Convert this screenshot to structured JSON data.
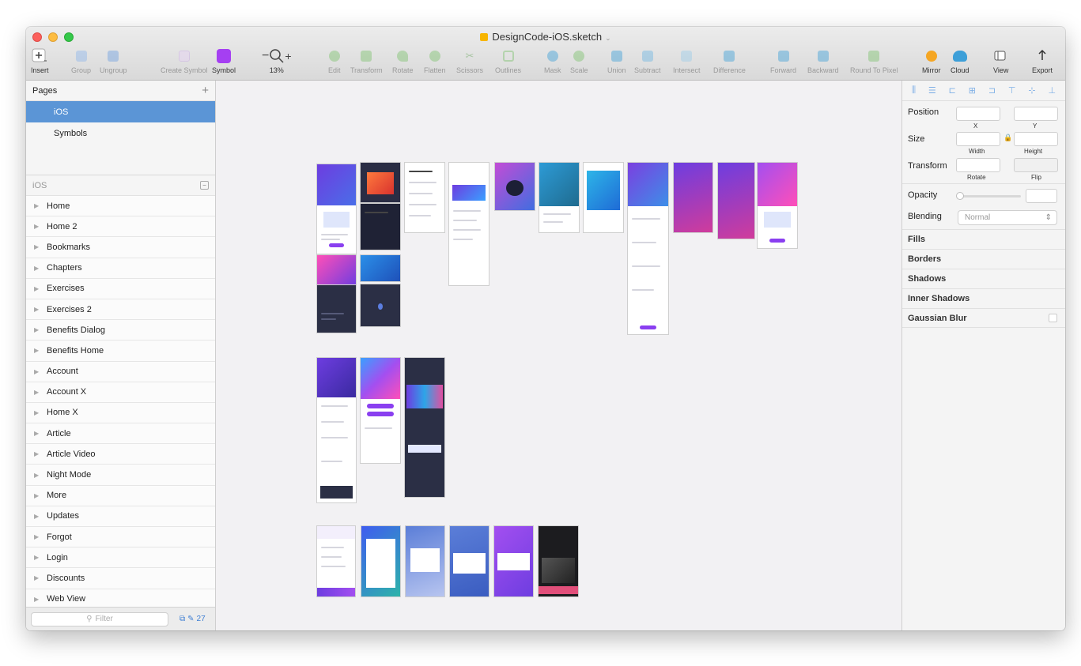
{
  "window": {
    "title": "DesignCode-iOS.sketch"
  },
  "toolbar": {
    "insert": "Insert",
    "group": "Group",
    "ungroup": "Ungroup",
    "create_symbol": "Create Symbol",
    "symbol": "Symbol",
    "zoom_minus": "−",
    "zoom_plus": "+",
    "zoom": "13%",
    "edit": "Edit",
    "transform": "Transform",
    "rotate": "Rotate",
    "flatten": "Flatten",
    "scissors": "Scissors",
    "outlines": "Outlines",
    "mask": "Mask",
    "scale": "Scale",
    "union": "Union",
    "subtract": "Subtract",
    "intersect": "Intersect",
    "difference": "Difference",
    "forward": "Forward",
    "backward": "Backward",
    "round_to_pixel": "Round To Pixel",
    "mirror": "Mirror",
    "cloud": "Cloud",
    "view": "View",
    "export": "Export"
  },
  "sidebar": {
    "pages_title": "Pages",
    "add": "+",
    "pages": [
      {
        "label": "iOS",
        "selected": true
      },
      {
        "label": "Symbols",
        "selected": false
      }
    ],
    "layers_title": "iOS",
    "layers": [
      "Home",
      "Home 2",
      "Bookmarks",
      "Chapters",
      "Exercises",
      "Exercises 2",
      "Benefits Dialog",
      "Benefits Home",
      "Account",
      "Account X",
      "Home X",
      "Article",
      "Article Video",
      "Night Mode",
      "More",
      "Updates",
      "Forgot",
      "Login",
      "Discounts",
      "Web View"
    ],
    "filter_placeholder": "Filter",
    "footer_count": "27"
  },
  "inspector": {
    "position": "Position",
    "x": "X",
    "y": "Y",
    "size": "Size",
    "width": "Width",
    "height": "Height",
    "transform": "Transform",
    "rotate": "Rotate",
    "flip": "Flip",
    "opacity": "Opacity",
    "blending": "Blending",
    "blending_value": "Normal",
    "fills": "Fills",
    "borders": "Borders",
    "shadows": "Shadows",
    "inner_shadows": "Inner Shadows",
    "gaussian_blur": "Gaussian Blur"
  },
  "colors": {
    "selection": "#5b95d6",
    "accent_purple": "#8a3ff0",
    "accent_blue": "#3f7fd3"
  }
}
